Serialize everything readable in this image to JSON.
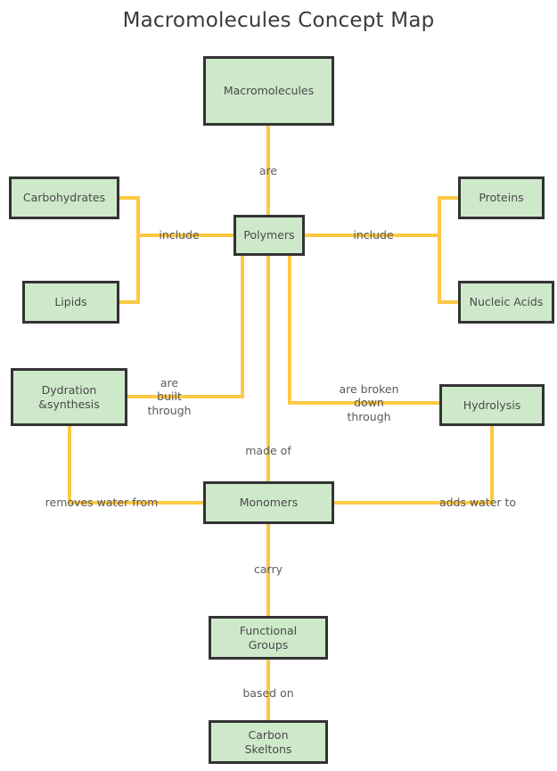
{
  "page": {
    "title": "Macromolecules Concept Map",
    "background_color": "#ffffff"
  },
  "style": {
    "node_fill": "#cee9ca",
    "node_border": "#333333",
    "edge_color": "#fdc943",
    "text_color": "#494949",
    "title_color": "#3b3b3b"
  },
  "nodes": {
    "macromolecules": {
      "label": "Macromolecules"
    },
    "polymers": {
      "label": "Polymers"
    },
    "carbohydrates": {
      "label": "Carbohydrates"
    },
    "lipids": {
      "label": "Lipids"
    },
    "proteins": {
      "label": "Proteins"
    },
    "nucleic_acids": {
      "label": "Nucleic Acids"
    },
    "dydration_synthesis": {
      "label": "Dydration\n&synthesis"
    },
    "hydrolysis": {
      "label": "Hydrolysis"
    },
    "monomers": {
      "label": "Monomers"
    },
    "functional_groups": {
      "label": "Functional\nGroups"
    },
    "carbon_skeltons": {
      "label": "Carbon\nSkeltons"
    }
  },
  "edges": {
    "are": {
      "label": "are",
      "from": "macromolecules",
      "to": "polymers"
    },
    "include_left": {
      "label": "include",
      "from": "carbohydrates / lipids",
      "to": "polymers"
    },
    "include_right": {
      "label": "include",
      "from": "polymers",
      "to": "proteins / nucleic acids"
    },
    "are_built_through": {
      "label": "are\nbuilt\nthrough",
      "from": "polymers",
      "to": "dydration_synthesis"
    },
    "are_broken_down_through": {
      "label": "are broken\ndown\nthrough",
      "from": "polymers",
      "to": "hydrolysis"
    },
    "made_of": {
      "label": "made of",
      "from": "polymers",
      "to": "monomers"
    },
    "removes_water_from": {
      "label": "removes water from",
      "from": "dydration_synthesis",
      "to": "monomers"
    },
    "adds_water_to": {
      "label": "adds water to",
      "from": "hydrolysis",
      "to": "monomers"
    },
    "carry": {
      "label": "carry",
      "from": "monomers",
      "to": "functional_groups"
    },
    "based_on": {
      "label": "based on",
      "from": "functional_groups",
      "to": "carbon_skeltons"
    }
  }
}
